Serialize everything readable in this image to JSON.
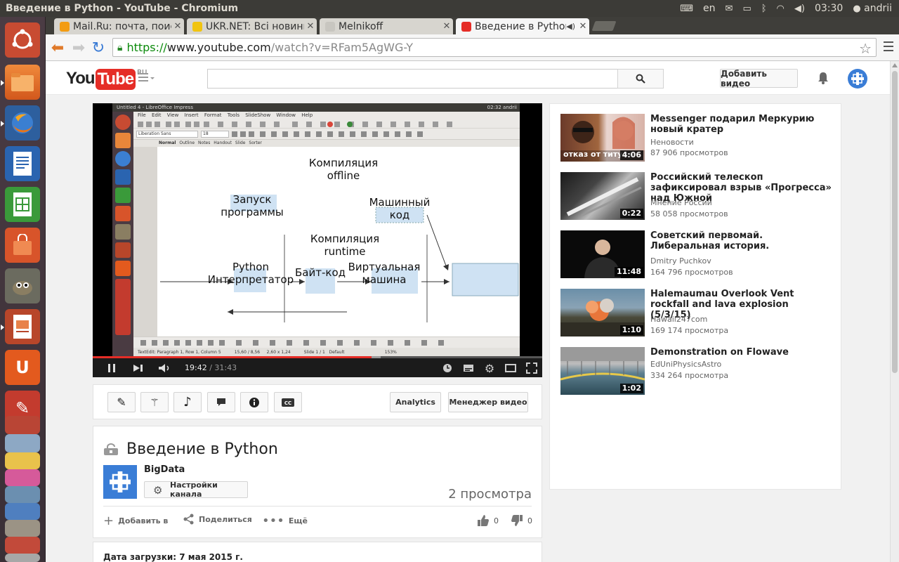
{
  "system": {
    "window_title": "Введение в Python - YouTube - Chromium",
    "keyboard_layout": "en",
    "clock": "03:30",
    "user": "andrii"
  },
  "browser": {
    "tabs": [
      {
        "label": "Mail.Ru: почта, поиск",
        "color": "#f39c12"
      },
      {
        "label": "UKR.NET: Всі новини",
        "color": "#f1c40f"
      },
      {
        "label": "Melnikoff",
        "color": "#bbbbbb"
      },
      {
        "label": "Введение в Python",
        "color": "#e52d27"
      }
    ],
    "url_scheme": "https://",
    "url_host": "www.youtube.com",
    "url_path": "/watch?v=RFam5AgWG-Y"
  },
  "youtube": {
    "logo_you": "You",
    "logo_tube": "Tube",
    "logo_region": "RU",
    "search_placeholder": "",
    "upload_label": "Добавить видео"
  },
  "player": {
    "current_time": "19:42",
    "duration": "/ 31:43",
    "progress_fraction": 0.62,
    "buffered_fraction": 0.64,
    "embedded": {
      "window_title": "Untitled 4 - LibreOffice Impress",
      "top_right": "02:32  andrii",
      "menu": "File Edit View Insert Format Tools SlideShow Window Help",
      "font_name": "Liberation Sans",
      "font_size": "18",
      "view_tabs": [
        "Normal",
        "Outline",
        "Notes",
        "Handout",
        "Slide Sorter"
      ],
      "status": "TextEdit: Paragraph 1, Row 1, Column 5          15,60 / 8,56     2,60 x 1,24          Slide 1 / 1   Default                              153%",
      "slide_labels": {
        "compile_offline": "Компиляция\noffline",
        "run_program": "Запуск\nпрограммы",
        "machine_code": "Машинный\nкод",
        "compile_runtime": "Компиляция\nruntime",
        "python_interp": "Python\nИнтерпретатор",
        "bytecode": "Байт-код",
        "vm": "Виртуальная\nмашина"
      }
    }
  },
  "actions": {
    "analytics": "Analytics",
    "video_manager": "Менеджер видео"
  },
  "video": {
    "title": "Введение в Python",
    "channel": "BigData",
    "channel_settings": "Настройки канала",
    "views": "2 просмотра",
    "add_to": "Добавить в",
    "share": "Поделиться",
    "more": "Ещё",
    "likes": "0",
    "dislikes": "0",
    "upload_date": "Дата загрузки: 7 мая 2015 г."
  },
  "related": [
    {
      "title": "Messenger подарил Меркурию новый кратер",
      "channel": "Неновости",
      "views": "87 906 просмотров",
      "duration": "4:06"
    },
    {
      "title": "Российский телескоп зафиксировал взрыв «Прогресса» над Южной",
      "channel": "Мнение России",
      "views": "58 058 просмотров",
      "duration": "0:22"
    },
    {
      "title": "Советский первомай. Либеральная история.",
      "channel": "Dmitry Puchkov",
      "views": "164 796 просмотров",
      "duration": "11:48"
    },
    {
      "title": "Halemaumau Overlook Vent rockfall and lava explosion (5/3/15)",
      "channel": "Hawaii247com",
      "views": "169 174 просмотра",
      "duration": "1:10"
    },
    {
      "title": "Demonstration on Flowave",
      "channel": "EdUniPhysicsAstro",
      "views": "334 264 просмотра",
      "duration": "1:02"
    }
  ],
  "related_thumb_caption": "отказ от титула"
}
